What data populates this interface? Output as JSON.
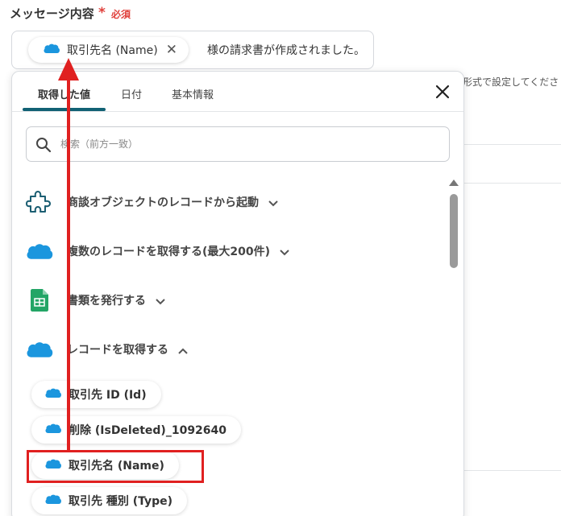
{
  "field": {
    "label": "メッセージ内容",
    "required_star": "*",
    "required_text": "必須"
  },
  "message": {
    "token_label": "取引先名 (Name)",
    "token_close": "✕",
    "rest_text": "様の請求書が作成されました。"
  },
  "background": {
    "hint_text": "形式で設定してくださ"
  },
  "panel": {
    "tabs": [
      {
        "label": "取得した値",
        "active": true
      },
      {
        "label": "日付",
        "active": false
      },
      {
        "label": "基本情報",
        "active": false
      }
    ],
    "search": {
      "placeholder": "検索（前方一致）",
      "value": ""
    },
    "sections": [
      {
        "label": "商談オブジェクトのレコードから起動",
        "icon": "puzzle-icon",
        "expanded": false
      },
      {
        "label": "複数のレコードを取得する(最大200件)",
        "icon": "salesforce-cloud-icon",
        "expanded": false
      },
      {
        "label": "書類を発行する",
        "icon": "google-sheets-icon",
        "expanded": false
      },
      {
        "label": "レコードを取得する",
        "icon": "salesforce-cloud-icon",
        "expanded": true
      }
    ],
    "items": [
      {
        "label": "取引先 ID (Id)"
      },
      {
        "label": "削除 (IsDeleted)_1092640"
      },
      {
        "label": "取引先名 (Name)",
        "highlighted": true
      },
      {
        "label": "取引先 種別 (Type)"
      }
    ]
  },
  "colors": {
    "accent": "#116174",
    "salesforce": "#1b96de",
    "annotation": "#e02020",
    "required": "#e0403b"
  }
}
